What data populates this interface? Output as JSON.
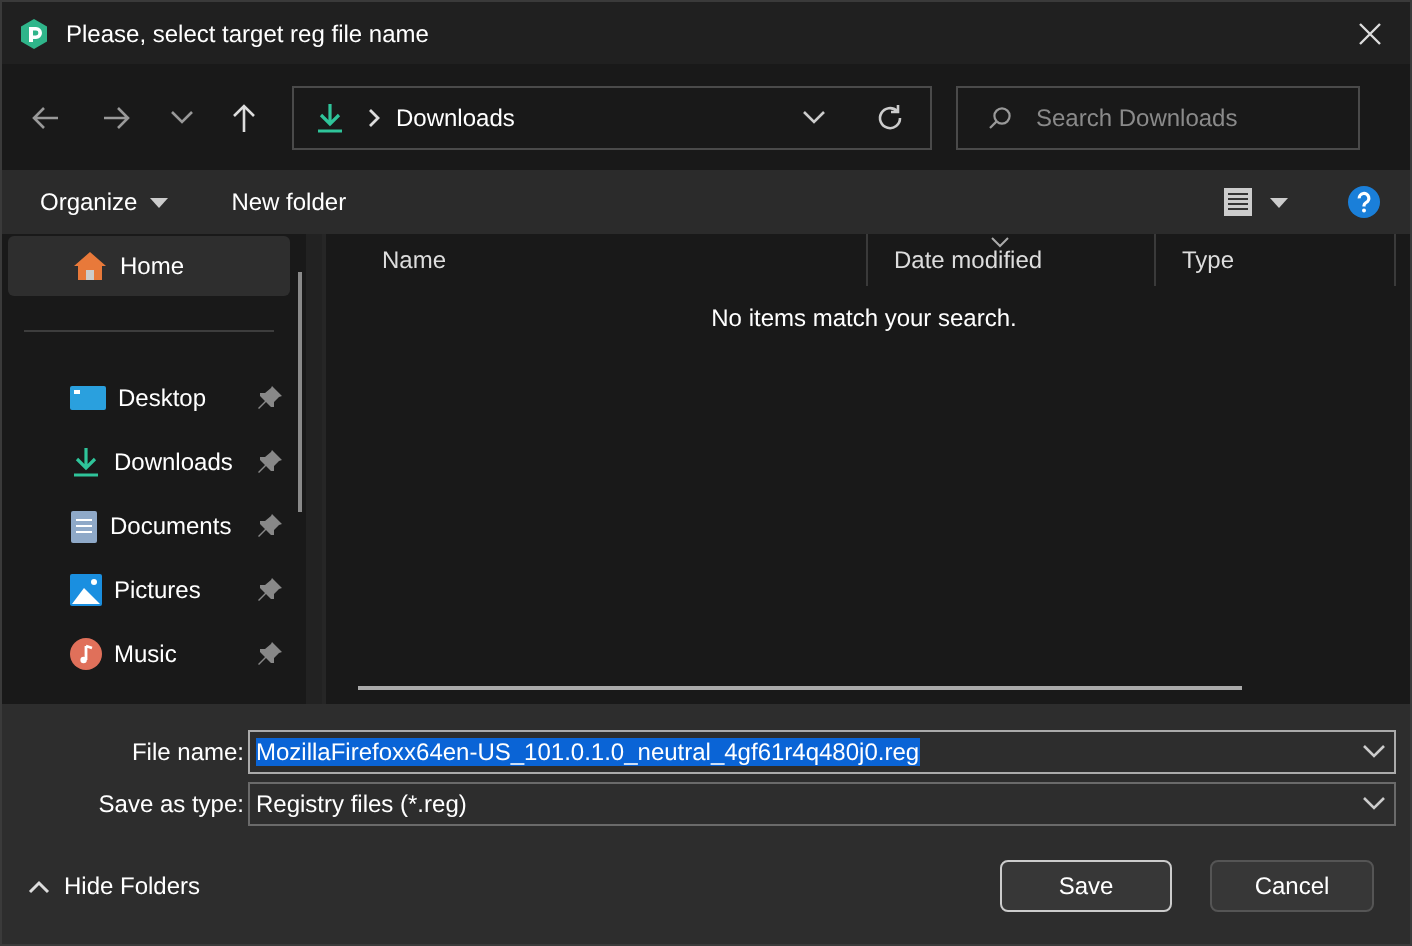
{
  "window": {
    "title": "Please, select target reg file name"
  },
  "navigation": {
    "breadcrumb": "Downloads",
    "search": {
      "placeholder": "Search Downloads"
    }
  },
  "toolbar": {
    "organize": "Organize",
    "new_folder": "New folder"
  },
  "sidebar": {
    "items": [
      {
        "label": "Home",
        "kind": "home",
        "selected": true,
        "pinned": false
      },
      {
        "label": "Desktop",
        "kind": "desktop",
        "selected": false,
        "pinned": true
      },
      {
        "label": "Downloads",
        "kind": "downloads",
        "selected": false,
        "pinned": true
      },
      {
        "label": "Documents",
        "kind": "documents",
        "selected": false,
        "pinned": true
      },
      {
        "label": "Pictures",
        "kind": "pictures",
        "selected": false,
        "pinned": true
      },
      {
        "label": "Music",
        "kind": "music",
        "selected": false,
        "pinned": true
      }
    ]
  },
  "table": {
    "columns": [
      "Name",
      "Date modified",
      "Type"
    ],
    "empty_message": "No items match your search."
  },
  "form": {
    "file_name": {
      "label": "File name:",
      "value": "MozillaFirefoxx64en-US_101.0.1.0_neutral_4gf61r4q480j0.reg"
    },
    "save_as_type": {
      "label": "Save as type:",
      "value": "Registry files (*.reg)"
    }
  },
  "footer": {
    "hide_folders": "Hide Folders",
    "buttons": [
      "Save",
      "Cancel"
    ]
  }
}
